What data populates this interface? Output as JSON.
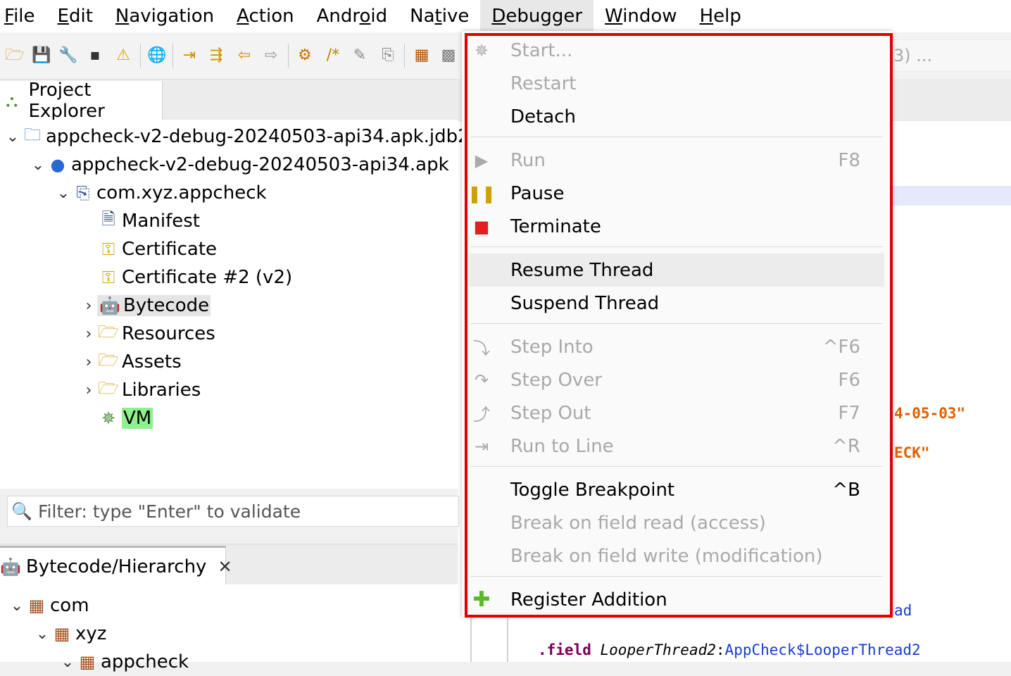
{
  "menubar": {
    "items": [
      {
        "label_mn": "F",
        "label_rest": "ile"
      },
      {
        "label_mn": "E",
        "label_rest": "dit"
      },
      {
        "label_mn": "N",
        "label_rest": "avigation"
      },
      {
        "label_mn": "A",
        "label_rest": "ction"
      },
      {
        "label_pre": "Andr",
        "label_mn": "o",
        "label_rest": "id"
      },
      {
        "label_pre": "Na",
        "label_mn": "t",
        "label_rest": "ive"
      },
      {
        "label_mn": "D",
        "label_rest": "ebugger"
      },
      {
        "label_mn": "W",
        "label_rest": "indow"
      },
      {
        "label_mn": "H",
        "label_rest": "elp"
      }
    ]
  },
  "right_field_text": "3) ...",
  "editor": {
    "line1": "4-05-03\"",
    "line2": "ECK\"",
    "line3": "ad",
    "line4_kw": ".field",
    "line4_name": "LooperThread2",
    "line4_colon": ":",
    "line4_type": "AppCheck$LooperThread2"
  },
  "project_explorer": {
    "tab_label": "Project Explorer",
    "tree": [
      {
        "label": "appcheck-v2-debug-20240503-api34.apk.jdb2"
      },
      {
        "label": "appcheck-v2-debug-20240503-api34.apk"
      },
      {
        "label": "com.xyz.appcheck"
      },
      {
        "label": "Manifest"
      },
      {
        "label": "Certificate"
      },
      {
        "label": "Certificate #2 (v2)"
      },
      {
        "label": "Bytecode"
      },
      {
        "label": "Resources"
      },
      {
        "label": "Assets"
      },
      {
        "label": "Libraries"
      },
      {
        "label": "VM"
      }
    ]
  },
  "filter": {
    "placeholder": "Filter: type \"Enter\" to validate"
  },
  "bytecode_hierarchy": {
    "tab_label": "Bytecode/Hierarchy",
    "close_glyph": "✕",
    "tree": [
      {
        "label": "com"
      },
      {
        "label": "xyz"
      },
      {
        "label": "appcheck"
      }
    ]
  },
  "debugger_menu": {
    "items": [
      {
        "label": "Start...",
        "key": "",
        "enabled": false
      },
      {
        "label": "Restart",
        "key": "",
        "enabled": false
      },
      {
        "label": "Detach",
        "key": "",
        "enabled": true
      },
      {
        "label": "Run",
        "key": "F8",
        "enabled": false
      },
      {
        "label": "Pause",
        "key": "",
        "enabled": true
      },
      {
        "label": "Terminate",
        "key": "",
        "enabled": true
      },
      {
        "label": "Resume Thread",
        "key": "",
        "enabled": true
      },
      {
        "label": "Suspend Thread",
        "key": "",
        "enabled": true
      },
      {
        "label": "Step Into",
        "key": "^F6",
        "enabled": false
      },
      {
        "label": "Step Over",
        "key": "F6",
        "enabled": false
      },
      {
        "label": "Step Out",
        "key": "F7",
        "enabled": false
      },
      {
        "label": "Run to Line",
        "key": "^R",
        "enabled": false
      },
      {
        "label": "Toggle Breakpoint",
        "key": "^B",
        "enabled": true
      },
      {
        "label": "Break on field read (access)",
        "key": "",
        "enabled": false
      },
      {
        "label": "Break on field write (modification)",
        "key": "",
        "enabled": false
      },
      {
        "label": "Register Addition",
        "key": "",
        "enabled": true
      }
    ]
  },
  "colors": {
    "highlight_outline": "#e00000",
    "vm_highlight": "#8ff08f",
    "string_literal": "#e06000",
    "type_ref": "#1a3bd6",
    "keyword": "#7a0055"
  }
}
